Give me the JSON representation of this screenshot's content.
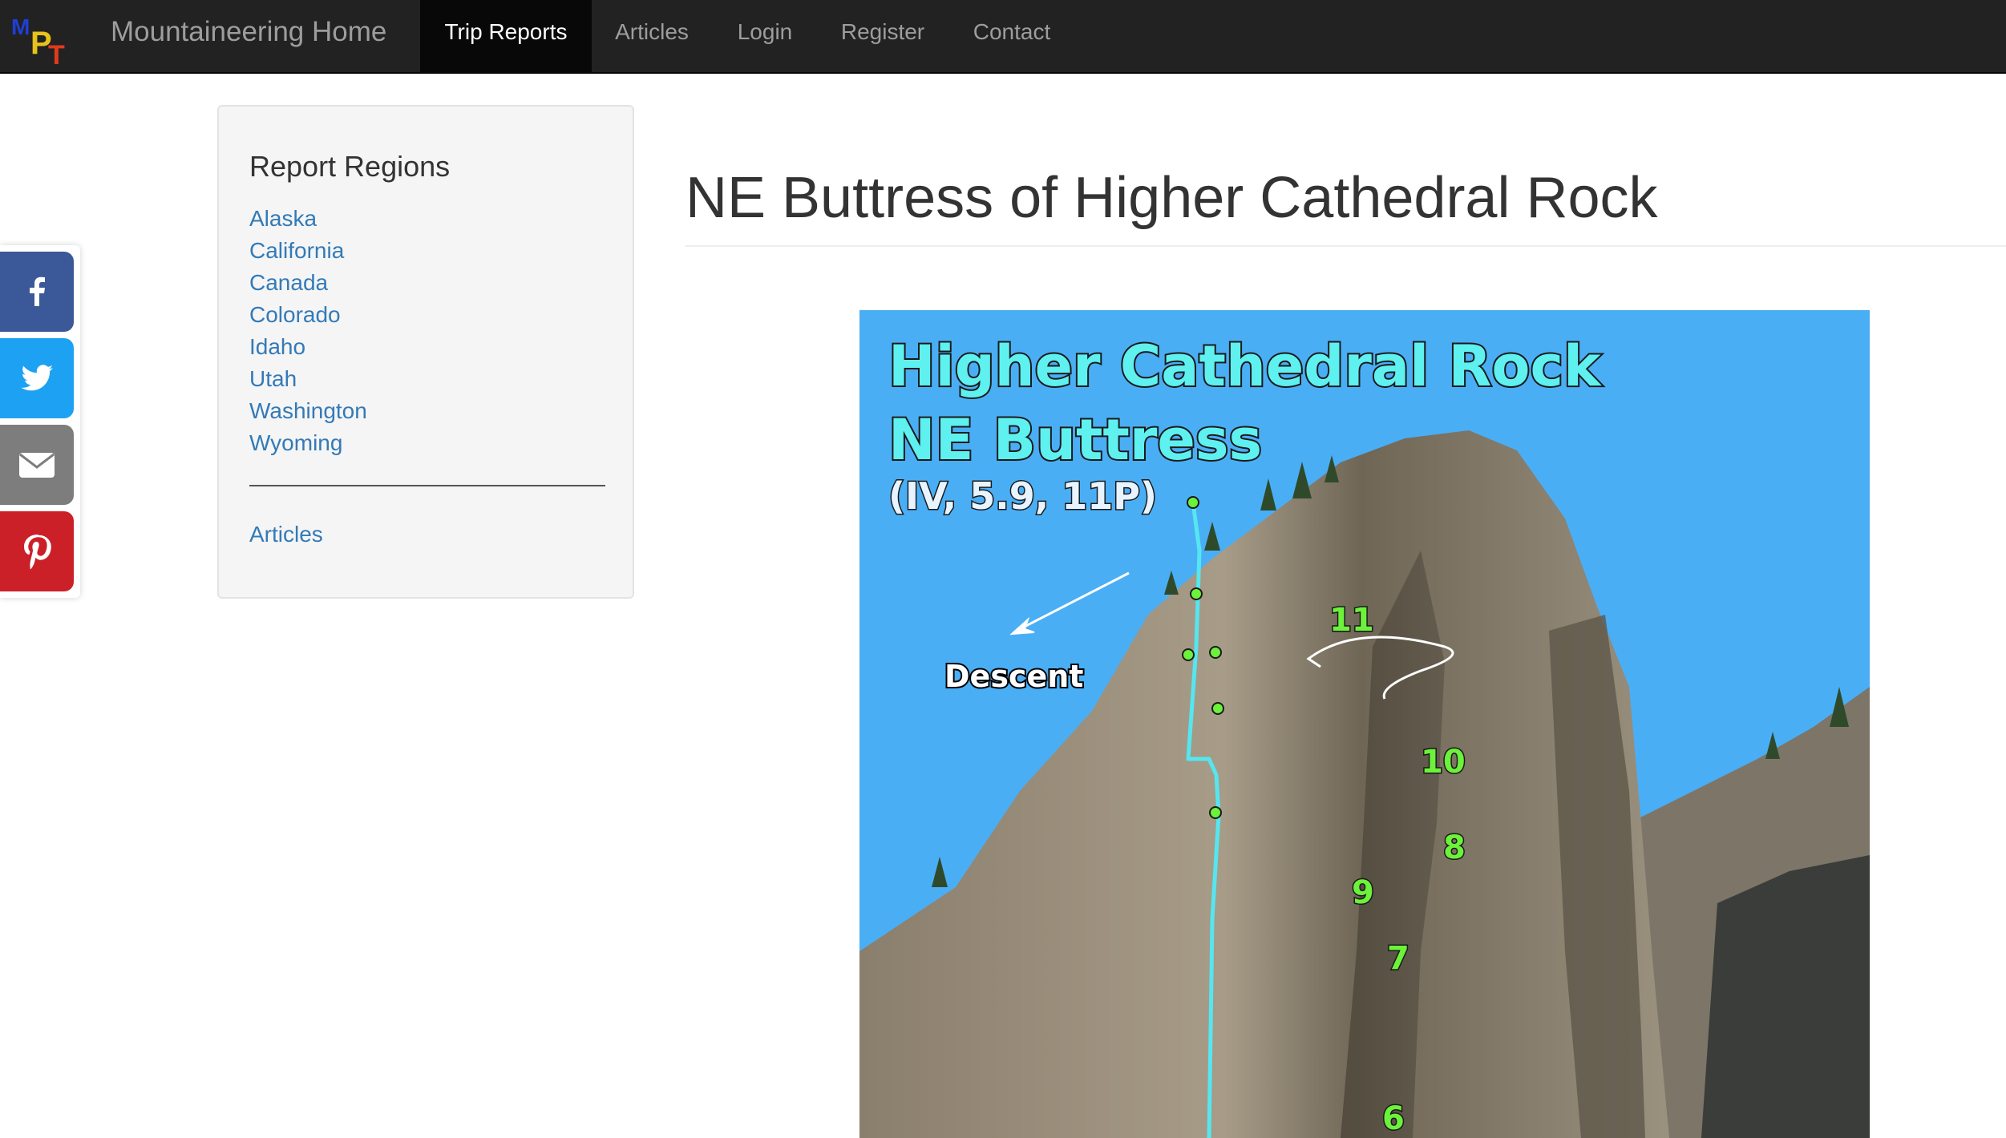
{
  "nav": {
    "logo": {
      "m": "M",
      "p": "P",
      "t": "T"
    },
    "brand": "Mountaineering Home",
    "items": [
      {
        "label": "Trip Reports",
        "active": true
      },
      {
        "label": "Articles",
        "active": false
      },
      {
        "label": "Login",
        "active": false
      },
      {
        "label": "Register",
        "active": false
      },
      {
        "label": "Contact",
        "active": false
      }
    ],
    "colors": {
      "bar": "#222222",
      "active_bg": "#080808",
      "text": "#9d9d9d"
    }
  },
  "share": {
    "buttons": [
      {
        "name": "facebook",
        "icon": "facebook-icon",
        "color": "#3b5998"
      },
      {
        "name": "twitter",
        "icon": "twitter-icon",
        "color": "#1da1f2"
      },
      {
        "name": "email",
        "icon": "envelope-icon",
        "color": "#7d7d7d"
      },
      {
        "name": "pinterest",
        "icon": "pinterest-icon",
        "color": "#cb2027"
      }
    ]
  },
  "sidebar": {
    "heading": "Report Regions",
    "regions": [
      "Alaska",
      "California",
      "Canada",
      "Colorado",
      "Idaho",
      "Utah",
      "Washington",
      "Wyoming"
    ],
    "articles_link": "Articles",
    "link_color": "#337ab7"
  },
  "main": {
    "title": "NE Buttress of Higher Cathedral Rock",
    "topo": {
      "title_line1": "Higher Cathedral Rock",
      "title_line2": "NE Buttress",
      "grade": "(IV, 5.9, 11P)",
      "descent_label": "Descent",
      "pitches": [
        "11",
        "10",
        "9",
        "8",
        "7",
        "6"
      ]
    }
  }
}
